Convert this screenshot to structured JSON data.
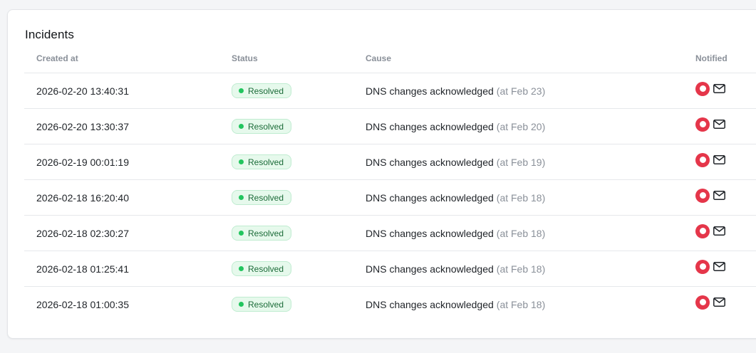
{
  "card": {
    "title": "Incidents"
  },
  "table": {
    "headers": {
      "created_at": "Created at",
      "status": "Status",
      "cause": "Cause",
      "notified": "Notified"
    },
    "rows": [
      {
        "created_at": "2026-02-20 13:40:31",
        "status": "Resolved",
        "cause": "DNS changes acknowledged",
        "cause_at": "(at Feb 23)"
      },
      {
        "created_at": "2026-02-20 13:30:37",
        "status": "Resolved",
        "cause": "DNS changes acknowledged",
        "cause_at": "(at Feb 20)"
      },
      {
        "created_at": "2026-02-19 00:01:19",
        "status": "Resolved",
        "cause": "DNS changes acknowledged",
        "cause_at": "(at Feb 19)"
      },
      {
        "created_at": "2026-02-18 16:20:40",
        "status": "Resolved",
        "cause": "DNS changes acknowledged",
        "cause_at": "(at Feb 18)"
      },
      {
        "created_at": "2026-02-18 02:30:27",
        "status": "Resolved",
        "cause": "DNS changes acknowledged",
        "cause_at": "(at Feb 18)"
      },
      {
        "created_at": "2026-02-18 01:25:41",
        "status": "Resolved",
        "cause": "DNS changes acknowledged",
        "cause_at": "(at Feb 18)"
      },
      {
        "created_at": "2026-02-18 01:00:35",
        "status": "Resolved",
        "cause": "DNS changes acknowledged",
        "cause_at": "(at Feb 18)"
      }
    ]
  },
  "icons": {
    "notify_channel": "red-circle-channel-icon",
    "notify_email": "mail-icon"
  },
  "colors": {
    "resolved_badge_bg": "#e6f9ec",
    "resolved_dot": "#22c55e",
    "resolved_text": "#1b6b38",
    "channel_icon": "#e5364a",
    "muted_text": "#8a9099"
  }
}
